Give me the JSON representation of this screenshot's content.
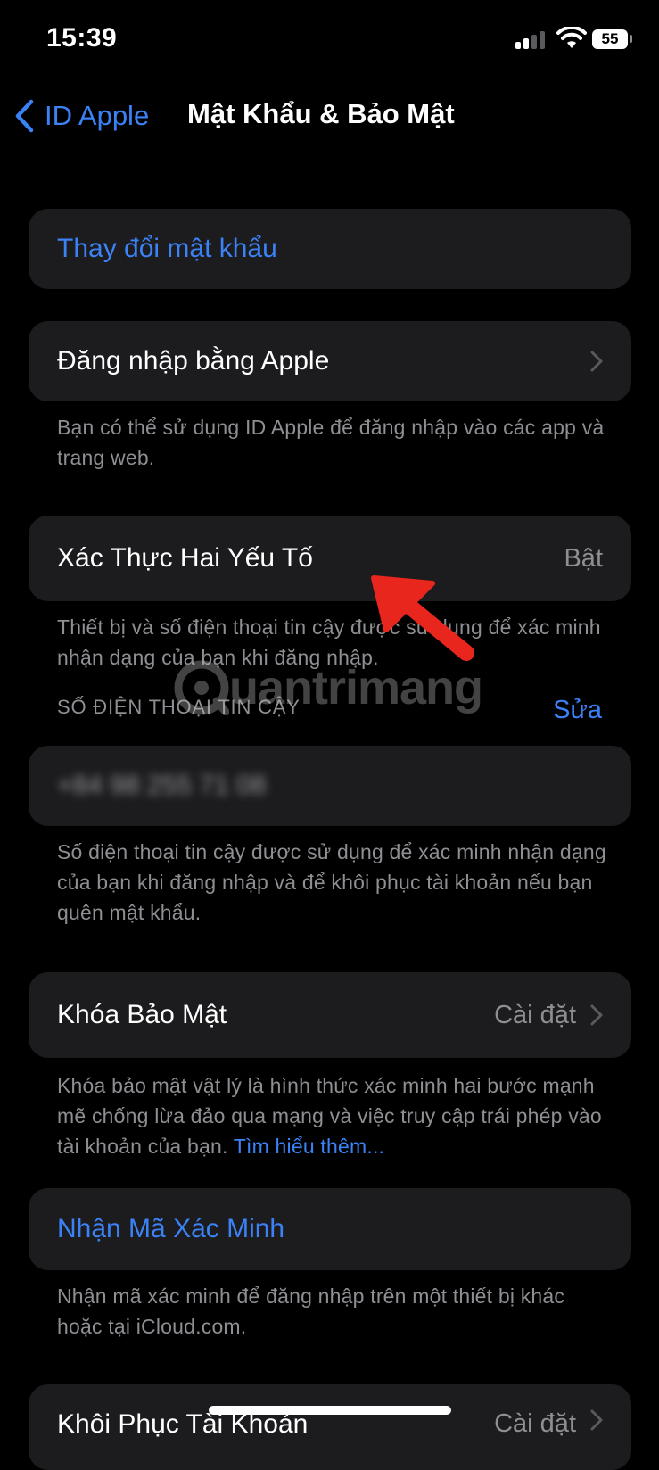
{
  "status_bar": {
    "time": "15:39",
    "battery": "55"
  },
  "nav": {
    "back_label": "ID Apple",
    "title": "Mật Khẩu & Bảo Mật"
  },
  "change_password": {
    "label": "Thay đổi mật khẩu"
  },
  "sign_in_apple": {
    "label": "Đăng nhập bằng Apple",
    "footer": "Bạn có thể sử dụng ID Apple để đăng nhập vào các app và trang web."
  },
  "two_factor": {
    "label": "Xác Thực Hai Yếu Tố",
    "value": "Bật",
    "footer": "Thiết bị và số điện thoại tin cậy được sử dụng để xác minh nhận dạng của bạn khi đăng nhập."
  },
  "trusted_numbers": {
    "header": "SỐ ĐIỆN THOẠI TIN CẬY",
    "edit_label": "Sửa",
    "phone": "+84 98 255 71 08",
    "footer": "Số điện thoại tin cậy được sử dụng để xác minh nhận dạng của bạn khi đăng nhập và để khôi phục tài khoản nếu bạn quên mật khẩu."
  },
  "security_keys": {
    "label": "Khóa Bảo Mật",
    "value": "Cài đặt",
    "footer": "Khóa bảo mật vật lý là hình thức xác minh hai bước mạnh mẽ chống lừa đảo qua mạng và việc truy cập trái phép vào tài khoản của bạn.",
    "footer_link": "Tìm hiểu thêm..."
  },
  "verification_code": {
    "label": "Nhận Mã Xác Minh",
    "footer": "Nhận mã xác minh để đăng nhập trên một thiết bị khác hoặc tại iCloud.com."
  },
  "account_recovery": {
    "label": "Khôi Phục Tài Khoản",
    "value": "Cài đặt"
  },
  "watermark": {
    "text": "uantrimang"
  },
  "colors": {
    "accent": "#3b82f6",
    "background": "#000000",
    "cell": "#1c1c1e",
    "secondary": "#8e8e93",
    "arrow": "#e8261d"
  }
}
